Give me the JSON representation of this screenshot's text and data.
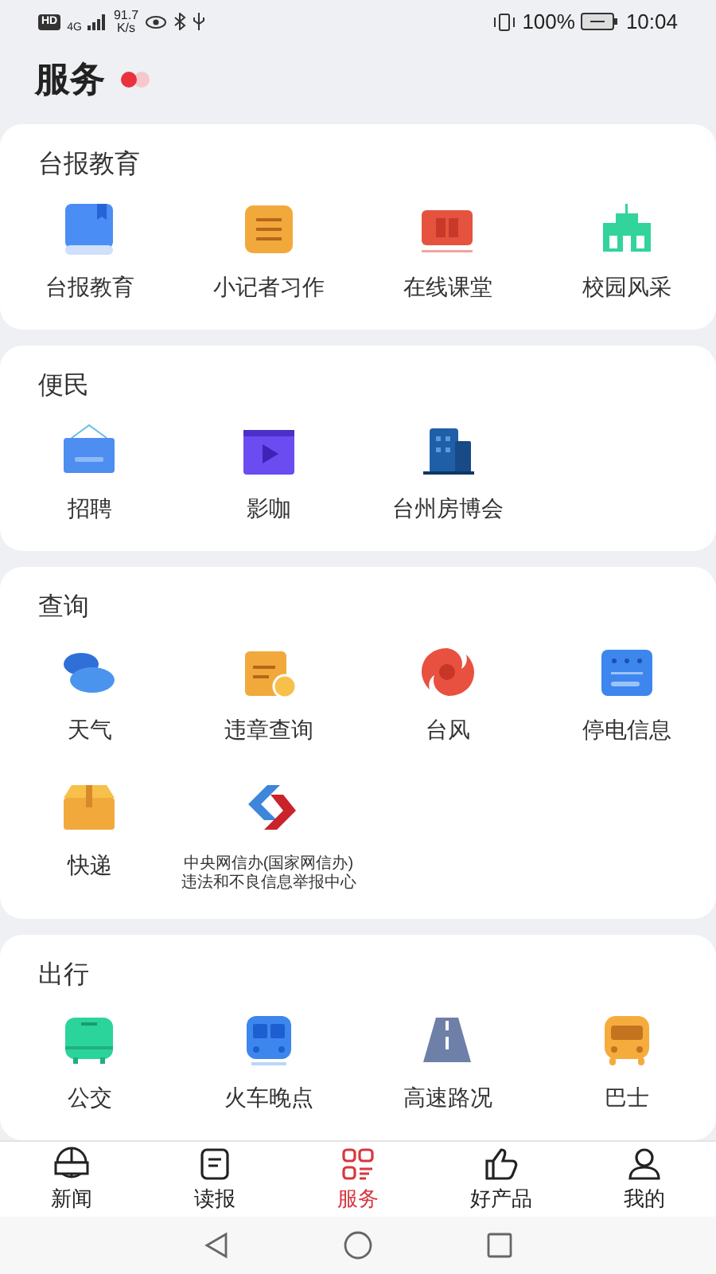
{
  "status_bar": {
    "hd": "HD",
    "network": "4G",
    "speed": "91.7",
    "speed_unit": "K/s",
    "battery": "100%",
    "time": "10:04"
  },
  "header": {
    "title": "服务"
  },
  "sections": [
    {
      "title": "台报教育",
      "items": [
        {
          "label": "台报教育"
        },
        {
          "label": "小记者习作"
        },
        {
          "label": "在线课堂"
        },
        {
          "label": "校园风采"
        }
      ]
    },
    {
      "title": "便民",
      "items": [
        {
          "label": "招聘"
        },
        {
          "label": "影咖"
        },
        {
          "label": "台州房博会"
        }
      ]
    },
    {
      "title": "查询",
      "items": [
        {
          "label": "天气"
        },
        {
          "label": "违章查询"
        },
        {
          "label": "台风"
        },
        {
          "label": "停电信息"
        },
        {
          "label": "快递"
        },
        {
          "kind": "caption",
          "lines": [
            "中央网信办(国家网信办)",
            "违法和不良信息举报中心"
          ]
        }
      ]
    },
    {
      "title": "出行",
      "items": [
        {
          "label": "公交"
        },
        {
          "label": "火车晚点"
        },
        {
          "label": "高速路况"
        },
        {
          "label": "巴士"
        }
      ]
    }
  ],
  "bottom_nav": [
    {
      "label": "新闻",
      "selected": false
    },
    {
      "label": "读报",
      "selected": false
    },
    {
      "label": "服务",
      "selected": true
    },
    {
      "label": "好产品",
      "selected": false
    },
    {
      "label": "我的",
      "selected": false
    }
  ]
}
